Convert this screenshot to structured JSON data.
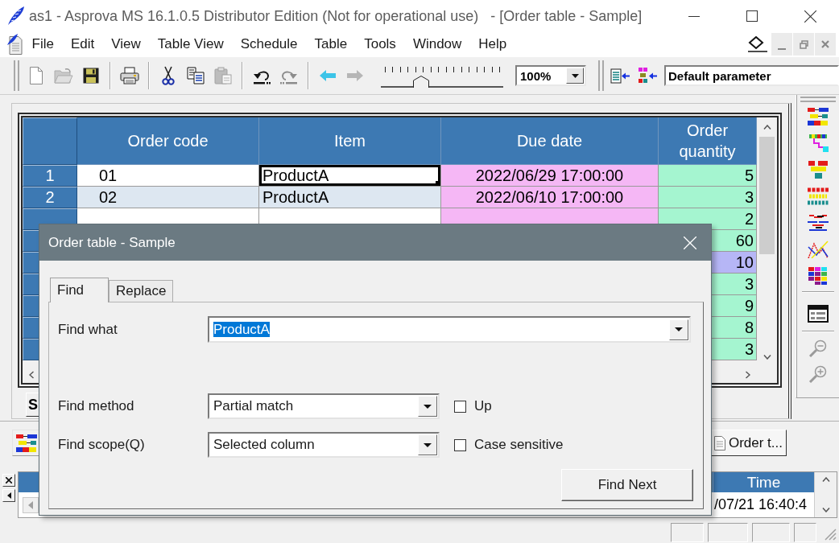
{
  "window": {
    "title": "as1 - Asprova MS 16.1.0.5 Distributor Edition (Not for operational use)   - [Order table - Sample]"
  },
  "menu": {
    "items": [
      "File",
      "Edit",
      "View",
      "Table View",
      "Schedule",
      "Table",
      "Tools",
      "Window",
      "Help"
    ]
  },
  "toolbar": {
    "groups": [
      [
        {
          "kind": "new",
          "disabled": false
        },
        {
          "kind": "open",
          "disabled": true
        },
        {
          "kind": "save",
          "disabled": false
        }
      ],
      [
        {
          "kind": "print",
          "disabled": false
        }
      ],
      [
        {
          "kind": "cut",
          "disabled": false
        },
        {
          "kind": "copy",
          "disabled": false
        },
        {
          "kind": "paste",
          "disabled": true
        }
      ],
      [
        {
          "kind": "undo",
          "disabled": false
        },
        {
          "kind": "redo",
          "disabled": true
        }
      ],
      [
        {
          "kind": "back",
          "disabled": false
        },
        {
          "kind": "forward",
          "disabled": true
        }
      ]
    ],
    "zoom_slider": {
      "level": 0.33
    },
    "zoom": "100%",
    "parameter": "Default parameter"
  },
  "table": {
    "columns": [
      "Order code",
      "Item",
      "Due date",
      "Order quantity"
    ],
    "rows": [
      {
        "number": "1",
        "order_code": "01",
        "item": "ProductA",
        "due_date": "2022/06/29 17:00:00",
        "quantity": "5",
        "color": "#a5f5d0",
        "current": true
      },
      {
        "number": "2",
        "order_code": "02",
        "item": "ProductA",
        "due_date": "2022/06/10 17:00:00",
        "quantity": "3",
        "color": "#a5f5d0",
        "current": false
      },
      {
        "quantity": "2",
        "color": "#a5f5d0",
        "current": false
      },
      {
        "quantity": "60",
        "color": "#a5f5d0"
      },
      {
        "quantity": "10",
        "color": "#b6b6f6"
      },
      {
        "quantity": "3",
        "color": "#a5f5d0"
      },
      {
        "quantity": "9",
        "color": "#a5f5d0"
      },
      {
        "quantity": "8",
        "color": "#a5f5d0"
      },
      {
        "quantity": "3",
        "color": "#a5f5d0"
      }
    ]
  },
  "sheet_button": "S",
  "window_tabs": [
    {
      "kind": "chart",
      "selected": false
    },
    {
      "kind": "table",
      "label": "Order t...",
      "selected": true
    }
  ],
  "output_pane": {
    "columns": [
      "Time"
    ],
    "rows": [
      [
        "/07/21 16:40:4"
      ]
    ]
  },
  "dialog": {
    "title": "Order table - Sample",
    "tabs": [
      {
        "label": "Find",
        "selected": true
      },
      {
        "label": "Replace",
        "selected": false
      }
    ],
    "find_what": {
      "label": "Find what",
      "value": "ProductA",
      "highlighted": true
    },
    "find_method": {
      "label": "Find method",
      "value": "Partial match",
      "option": {
        "label": "Up",
        "checked": false
      }
    },
    "find_scope": {
      "label": "Find scope(Q)",
      "value": "Selected column",
      "option": {
        "label": "Case sensitive",
        "checked": false
      }
    },
    "button": "Find Next"
  }
}
